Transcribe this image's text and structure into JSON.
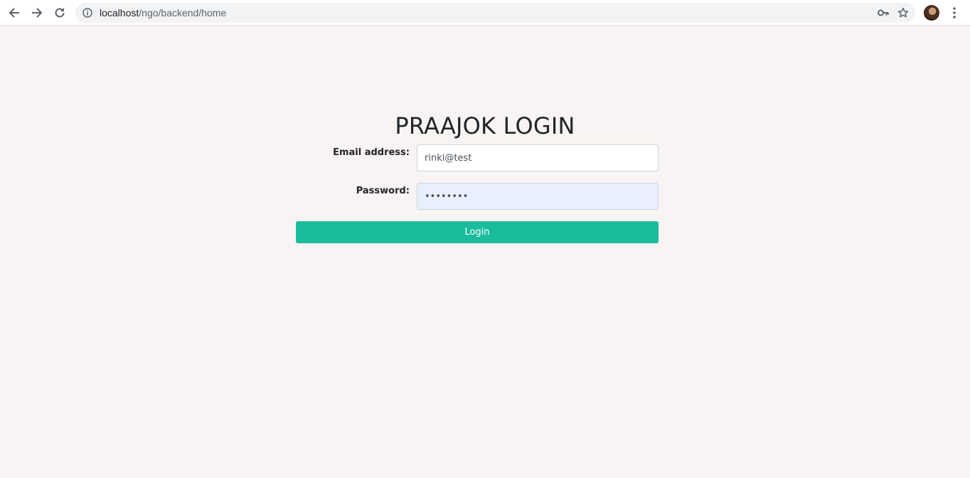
{
  "browser": {
    "url_host": "localhost",
    "url_path": "/ngo/backend/home",
    "icons": {
      "back": "back-arrow-icon",
      "forward": "forward-arrow-icon",
      "reload": "reload-icon",
      "info": "info-icon",
      "key": "key-icon",
      "star": "star-icon",
      "menu": "more-vertical-icon"
    }
  },
  "login": {
    "title": "PRAAJOK LOGIN",
    "email_label": "Email address:",
    "email_value": "rinki@test",
    "password_label": "Password:",
    "password_value": "password",
    "button_label": "Login"
  },
  "colors": {
    "page_background": "#f8f4f3",
    "button": "#1abc9c",
    "autofill": "#e8f0fe"
  }
}
